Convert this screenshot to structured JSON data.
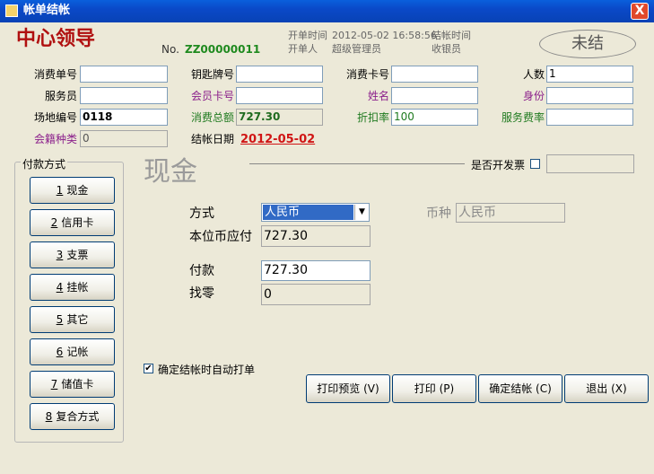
{
  "window": {
    "title": "帐单结帐",
    "close_glyph": "X"
  },
  "header": {
    "big_title": "中心领导",
    "no_label": "No.",
    "no_value": "ZZ00000011",
    "open_time_label": "开单时间",
    "open_time_value": "2012-05-02 16:58:56",
    "close_time_label": "结帐时间",
    "opener_label": "开单人",
    "opener_value": "超级管理员",
    "cashier_label": "收银员",
    "status": "未结"
  },
  "form": {
    "consume_no_label": "消费单号",
    "consume_no_value": "",
    "key_no_label": "钥匙牌号",
    "key_no_value": "",
    "consume_card_label": "消费卡号",
    "consume_card_value": "",
    "people_label": "人数",
    "people_value": "1",
    "waiter_label": "服务员",
    "waiter_value": "",
    "member_card_label": "会员卡号",
    "member_card_value": "",
    "name_label": "姓名",
    "name_value": "",
    "identity_label": "身份",
    "identity_value": "",
    "venue_label": "场地编号",
    "venue_value": "0118",
    "total_label": "消费总额",
    "total_value": "727.30",
    "discount_label": "折扣率",
    "discount_value": "100",
    "service_rate_label": "服务费率",
    "service_rate_value": "",
    "member_type_label": "会籍种类",
    "member_type_value": "0",
    "checkout_date_label": "结帐日期",
    "checkout_date_value": "2012-05-02"
  },
  "payment_group": {
    "title": "付款方式",
    "methods": [
      {
        "num": "1",
        "label": "现金"
      },
      {
        "num": "2",
        "label": "信用卡"
      },
      {
        "num": "3",
        "label": "支票"
      },
      {
        "num": "4",
        "label": "挂帐"
      },
      {
        "num": "5",
        "label": "其它"
      },
      {
        "num": "6",
        "label": "记帐"
      },
      {
        "num": "7",
        "label": "储值卡"
      },
      {
        "num": "8",
        "label": "复合方式"
      }
    ]
  },
  "payment": {
    "current_method": "现金",
    "invoice_label": "是否开发票",
    "invoice_checked": "",
    "invoice_value": "",
    "mode_label": "方式",
    "mode_value": "人民币",
    "currency_label": "币种",
    "currency_value": "人民币",
    "local_due_label": "本位币应付",
    "local_due_value": "727.30",
    "paid_label": "付款",
    "paid_value": "727.30",
    "change_label": "找零",
    "change_value": "0",
    "auto_print_label": "确定结帐时自动打单",
    "auto_print_checked": "✔"
  },
  "actions": {
    "print_preview": "打印预览 (V)",
    "print": "打印 (P)",
    "confirm": "确定结帐 (C)",
    "exit": "退出 (X)"
  }
}
